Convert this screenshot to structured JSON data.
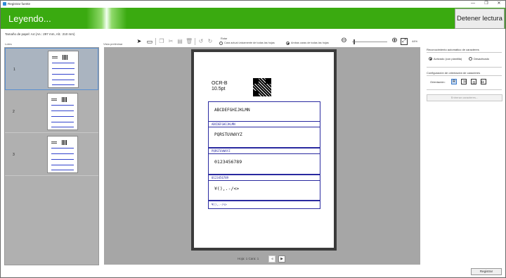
{
  "window": {
    "title": "Registrar fuente",
    "minimize": "—",
    "maximize": "❐",
    "close": "✕"
  },
  "banner": {
    "status": "Leyendo...",
    "stop_label": "Detener lectura",
    "accent": "#3aaa10"
  },
  "paper_info": "Tamaño de papel:  A4  (An.: 297 mm, Alt.: 210 mm)",
  "lots": {
    "label": "Lotes",
    "items": [
      {
        "num": "1",
        "selected": true
      },
      {
        "num": "2",
        "selected": false
      },
      {
        "num": "3",
        "selected": false
      }
    ]
  },
  "preview": {
    "label": "Vista preliminar"
  },
  "toolbar": {
    "rotate_label": "Rotar",
    "rotate_opt1": "Cara actual únicamente de todas las hojas",
    "rotate_opt2": "Ambas caras de todas las hojas",
    "zoom_value": "44%"
  },
  "document": {
    "font_name": "OCR-B",
    "font_size": "10.5pt",
    "rows": [
      {
        "big": "ABCDEFGHIJKLMN",
        "small": "ABCDEFGHIJKLMN"
      },
      {
        "big": "PQRSTUVWXYZ",
        "small": "PQRSTUVWXYZ"
      },
      {
        "big": "0123456789",
        "small": "0123456789"
      },
      {
        "big": "¥(),.-/<>",
        "small": "¥(),.-/<>"
      }
    ]
  },
  "pager": {
    "text": "Hoja: 1   Cara: 1",
    "prev": "◀",
    "next": "▶"
  },
  "right": {
    "auto_title": "Reconocimiento automático de caracteres",
    "auto_on": "Activado (con plantilla)",
    "auto_off": "Desactivado",
    "orient_title": "Configuración de orientación de caracteres",
    "orient_label": "Orientación:",
    "orient_options": [
      "R",
      "R",
      "R",
      "R"
    ],
    "advanced_button": "Entrenar caracteres..."
  },
  "footer": {
    "register_label": "Registrar"
  }
}
